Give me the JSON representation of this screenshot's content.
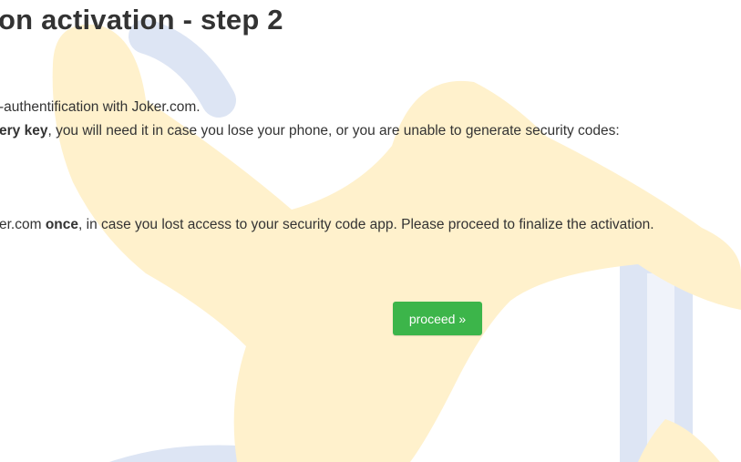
{
  "page": {
    "title": "on activation - step 2"
  },
  "body": {
    "line1": "-authentification with Joker.com.",
    "line2_bold": "ery key",
    "line2_rest": ", you will need it in case you lose your phone, or you are unable to generate security codes:",
    "line3_start": "er.com ",
    "line3_bold": "once",
    "line3_rest": ", in case you lost access to your security code app. Please proceed to finalize the activation."
  },
  "actions": {
    "proceed_label": "proceed »",
    "proceed_color": "#3cb54a"
  },
  "watermark": {
    "icon": "joker-star-logo-icon",
    "colors": {
      "star": "#fff1cc",
      "ring": "#dde5f4"
    }
  }
}
